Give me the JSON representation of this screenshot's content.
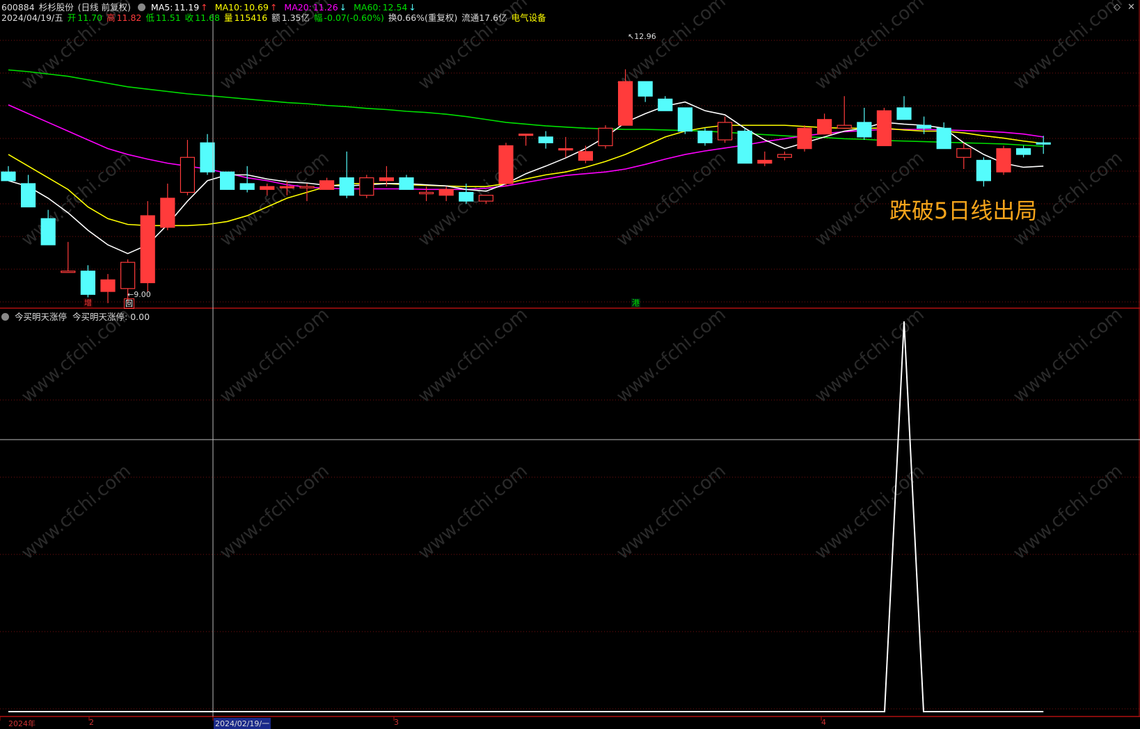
{
  "header": {
    "stock_code": "600884",
    "stock_name": "杉杉股份",
    "period": "(日线 前复权)",
    "ma5_label": "MA5:",
    "ma5_value": "11.19",
    "ma5_arrow": "↑",
    "ma10_label": "MA10:",
    "ma10_value": "10.69",
    "ma10_arrow": "↑",
    "ma20_label": "MA20:",
    "ma20_value": "11.26",
    "ma20_arrow": "↓",
    "ma60_label": "MA60:",
    "ma60_value": "12.54",
    "ma60_arrow": "↓"
  },
  "info_row": {
    "date": "2024/04/19/五",
    "open_label": "开",
    "open": "11.70",
    "high_label": "高",
    "high": "11.82",
    "low_label": "低",
    "low": "11.51",
    "close_label": "收",
    "close": "11.68",
    "vol_label": "量",
    "vol": "115416",
    "amount_label": "额",
    "amount": "1.35亿",
    "change_label": "幅",
    "change": "-0.07(-0.60%)",
    "turnover": "换0.66%(重复权)",
    "float_cap": "流通17.6亿",
    "industry": "电气设备"
  },
  "price_pane": {
    "high_mark": "12.96",
    "low_mark": "9.00",
    "annotation": "跌破5日线出局",
    "event_tags": [
      "增",
      "回",
      "港"
    ]
  },
  "indicator_pane": {
    "name": "今买明天涨停",
    "value_label": "今买明天涨停:",
    "value": "0.00"
  },
  "x_axis": {
    "labels": [
      "2024年",
      "2",
      "2024/02/19/一",
      "3",
      "4"
    ]
  },
  "colors": {
    "up": "#ff3b3b",
    "down": "#54fcfc",
    "ma5": "#ffffff",
    "ma10": "#ffff00",
    "ma20": "#ff00ff",
    "ma60": "#00e000",
    "annotation": "#f5a41b"
  },
  "chart_data": {
    "type": "candlestick",
    "y_range": [
      8.9,
      13.6
    ],
    "candles": [
      {
        "o": 11.2,
        "h": 11.3,
        "l": 11.05,
        "c": 11.05
      },
      {
        "o": 11.0,
        "h": 11.15,
        "l": 10.6,
        "c": 10.6
      },
      {
        "o": 10.4,
        "h": 10.55,
        "l": 9.95,
        "c": 9.95
      },
      {
        "o": 9.5,
        "h": 10.0,
        "l": 9.5,
        "c": 9.5
      },
      {
        "o": 9.5,
        "h": 9.6,
        "l": 9.05,
        "c": 9.1
      },
      {
        "o": 9.15,
        "h": 9.45,
        "l": 8.95,
        "c": 9.35
      },
      {
        "o": 9.2,
        "h": 9.7,
        "l": 8.95,
        "c": 9.65
      },
      {
        "o": 9.3,
        "h": 10.7,
        "l": 9.15,
        "c": 10.45
      },
      {
        "o": 10.25,
        "h": 11.0,
        "l": 10.2,
        "c": 10.75
      },
      {
        "o": 10.85,
        "h": 11.75,
        "l": 10.8,
        "c": 11.45
      },
      {
        "o": 11.7,
        "h": 11.85,
        "l": 11.15,
        "c": 11.2
      },
      {
        "o": 11.2,
        "h": 11.2,
        "l": 10.9,
        "c": 10.9
      },
      {
        "o": 11.0,
        "h": 11.3,
        "l": 10.85,
        "c": 10.9
      },
      {
        "o": 10.9,
        "h": 11.0,
        "l": 10.8,
        "c": 10.95
      },
      {
        "o": 10.95,
        "h": 11.05,
        "l": 10.8,
        "c": 10.95
      },
      {
        "o": 10.95,
        "h": 11.0,
        "l": 10.7,
        "c": 10.95
      },
      {
        "o": 10.9,
        "h": 11.1,
        "l": 10.9,
        "c": 11.05
      },
      {
        "o": 11.1,
        "h": 11.55,
        "l": 10.75,
        "c": 10.8
      },
      {
        "o": 10.8,
        "h": 11.15,
        "l": 10.75,
        "c": 11.1
      },
      {
        "o": 11.05,
        "h": 11.3,
        "l": 10.95,
        "c": 11.1
      },
      {
        "o": 11.1,
        "h": 11.15,
        "l": 10.9,
        "c": 10.9
      },
      {
        "o": 10.85,
        "h": 10.95,
        "l": 10.7,
        "c": 10.85
      },
      {
        "o": 10.8,
        "h": 10.95,
        "l": 10.7,
        "c": 10.9
      },
      {
        "o": 10.85,
        "h": 11.0,
        "l": 10.65,
        "c": 10.7
      },
      {
        "o": 10.7,
        "h": 10.75,
        "l": 10.65,
        "c": 10.8
      },
      {
        "o": 11.0,
        "h": 11.7,
        "l": 10.95,
        "c": 11.65
      },
      {
        "o": 11.85,
        "h": 11.85,
        "l": 11.65,
        "c": 11.85
      },
      {
        "o": 11.8,
        "h": 11.9,
        "l": 11.6,
        "c": 11.7
      },
      {
        "o": 11.6,
        "h": 11.8,
        "l": 11.45,
        "c": 11.6
      },
      {
        "o": 11.4,
        "h": 11.65,
        "l": 11.35,
        "c": 11.55
      },
      {
        "o": 11.65,
        "h": 12.0,
        "l": 11.6,
        "c": 11.95
      },
      {
        "o": 12.0,
        "h": 12.96,
        "l": 12.0,
        "c": 12.75
      },
      {
        "o": 12.75,
        "h": 12.75,
        "l": 12.4,
        "c": 12.5
      },
      {
        "o": 12.45,
        "h": 12.5,
        "l": 12.25,
        "c": 12.25
      },
      {
        "o": 12.3,
        "h": 12.3,
        "l": 11.85,
        "c": 11.9
      },
      {
        "o": 11.9,
        "h": 11.95,
        "l": 11.65,
        "c": 11.7
      },
      {
        "o": 11.75,
        "h": 12.15,
        "l": 11.7,
        "c": 12.05
      },
      {
        "o": 11.9,
        "h": 11.95,
        "l": 11.35,
        "c": 11.35
      },
      {
        "o": 11.35,
        "h": 11.55,
        "l": 11.3,
        "c": 11.4
      },
      {
        "o": 11.45,
        "h": 11.55,
        "l": 11.4,
        "c": 11.5
      },
      {
        "o": 11.6,
        "h": 12.0,
        "l": 11.55,
        "c": 11.95
      },
      {
        "o": 11.85,
        "h": 12.2,
        "l": 11.85,
        "c": 12.1
      },
      {
        "o": 11.95,
        "h": 12.5,
        "l": 11.95,
        "c": 12.0
      },
      {
        "o": 12.05,
        "h": 12.3,
        "l": 11.75,
        "c": 11.8
      },
      {
        "o": 11.65,
        "h": 12.3,
        "l": 11.65,
        "c": 12.25
      },
      {
        "o": 12.3,
        "h": 12.5,
        "l": 12.1,
        "c": 12.1
      },
      {
        "o": 12.0,
        "h": 12.15,
        "l": 11.85,
        "c": 11.95
      },
      {
        "o": 11.95,
        "h": 12.05,
        "l": 11.6,
        "c": 11.6
      },
      {
        "o": 11.45,
        "h": 11.7,
        "l": 11.25,
        "c": 11.6
      },
      {
        "o": 11.4,
        "h": 11.45,
        "l": 10.95,
        "c": 11.05
      },
      {
        "o": 11.2,
        "h": 11.65,
        "l": 11.15,
        "c": 11.6
      },
      {
        "o": 11.6,
        "h": 11.65,
        "l": 11.45,
        "c": 11.5
      },
      {
        "o": 11.7,
        "h": 11.82,
        "l": 11.51,
        "c": 11.68
      }
    ],
    "ma5": [
      11.05,
      10.95,
      10.75,
      10.5,
      10.2,
      9.95,
      9.8,
      9.95,
      10.3,
      10.7,
      11.05,
      11.15,
      11.15,
      11.08,
      11.03,
      11.01,
      10.97,
      10.96,
      10.98,
      11.0,
      11.0,
      10.98,
      10.96,
      10.9,
      10.87,
      11.0,
      11.17,
      11.3,
      11.44,
      11.6,
      11.8,
      12.05,
      12.2,
      12.33,
      12.4,
      12.25,
      12.18,
      11.95,
      11.75,
      11.6,
      11.7,
      11.8,
      11.9,
      11.95,
      12.05,
      12.02,
      12.0,
      11.95,
      11.7,
      11.5,
      11.35,
      11.28,
      11.3
    ],
    "ma10": [
      11.5,
      11.3,
      11.1,
      10.9,
      10.6,
      10.4,
      10.3,
      10.28,
      10.28,
      10.28,
      10.3,
      10.35,
      10.45,
      10.6,
      10.75,
      10.85,
      10.95,
      11.0,
      11.0,
      11.0,
      10.98,
      10.97,
      10.96,
      10.95,
      10.95,
      11.0,
      11.08,
      11.15,
      11.2,
      11.28,
      11.38,
      11.5,
      11.65,
      11.8,
      11.9,
      11.96,
      12.0,
      12.0,
      12.0,
      12.0,
      11.98,
      11.96,
      11.95,
      11.95,
      11.95,
      11.92,
      11.9,
      11.9,
      11.87,
      11.82,
      11.78,
      11.73,
      11.69
    ],
    "ma20": [
      12.35,
      12.2,
      12.05,
      11.9,
      11.75,
      11.6,
      11.5,
      11.42,
      11.35,
      11.3,
      11.25,
      11.18,
      11.1,
      11.05,
      10.98,
      10.94,
      10.92,
      10.91,
      10.91,
      10.91,
      10.91,
      10.9,
      10.9,
      10.9,
      10.92,
      10.96,
      11.02,
      11.08,
      11.14,
      11.17,
      11.2,
      11.25,
      11.33,
      11.42,
      11.5,
      11.56,
      11.61,
      11.66,
      11.72,
      11.77,
      11.82,
      11.86,
      11.89,
      11.91,
      11.93,
      11.93,
      11.93,
      11.92,
      11.91,
      11.9,
      11.88,
      11.85,
      11.8
    ],
    "ma60": [
      12.95,
      12.92,
      12.88,
      12.84,
      12.78,
      12.72,
      12.66,
      12.62,
      12.58,
      12.54,
      12.51,
      12.48,
      12.45,
      12.42,
      12.39,
      12.37,
      12.34,
      12.32,
      12.29,
      12.27,
      12.24,
      12.22,
      12.19,
      12.15,
      12.1,
      12.05,
      12.02,
      11.99,
      11.97,
      11.95,
      11.94,
      11.93,
      11.93,
      11.92,
      11.91,
      11.9,
      11.88,
      11.86,
      11.84,
      11.82,
      11.8,
      11.79,
      11.77,
      11.76,
      11.74,
      11.73,
      11.72,
      11.71,
      11.7,
      11.69,
      11.68,
      11.66,
      11.64
    ],
    "indicator": {
      "name": "今买明天涨停",
      "values": [
        0,
        0,
        0,
        0,
        0,
        0,
        0,
        0,
        0,
        0,
        0,
        0,
        0,
        0,
        0,
        0,
        0,
        0,
        0,
        0,
        0,
        0,
        0,
        0,
        0,
        0,
        0,
        0,
        0,
        0,
        0,
        0,
        0,
        0,
        0,
        0,
        0,
        0,
        0,
        0,
        0,
        0,
        0,
        0,
        0,
        1,
        0,
        0,
        0,
        0,
        0,
        0,
        0
      ]
    }
  }
}
